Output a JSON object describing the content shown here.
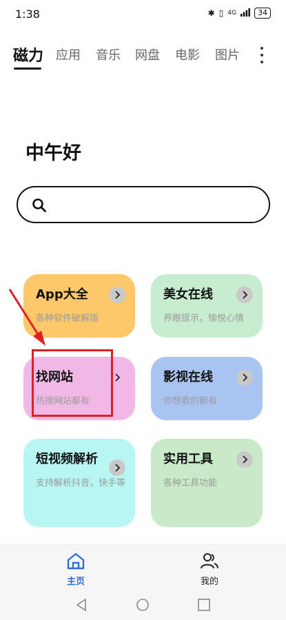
{
  "status_bar": {
    "time": "1:38",
    "bluetooth": "✱",
    "vibrate": "▯",
    "network": "4G",
    "battery": "34"
  },
  "tabs": [
    {
      "label": "磁力",
      "active": true
    },
    {
      "label": "应用"
    },
    {
      "label": "音乐"
    },
    {
      "label": "网盘"
    },
    {
      "label": "电影"
    },
    {
      "label": "图片"
    }
  ],
  "greeting": "中午好",
  "search": {
    "placeholder": "",
    "value": ""
  },
  "cards": [
    {
      "title": "App大全",
      "subtitle": "各种软件破解版",
      "color": "#fcc86a"
    },
    {
      "title": "美女在线",
      "subtitle": "养眼提示，愉悦心情",
      "color": "#c8ecd0"
    },
    {
      "title": "找网站",
      "subtitle": "热搜网站都有",
      "color": "#f1b8e6"
    },
    {
      "title": "影视在线",
      "subtitle": "你想看的都有",
      "color": "#a9c4f0"
    },
    {
      "title": "短视频解析",
      "subtitle": "支持解析抖音，快手等",
      "color": "#b7f6f2"
    },
    {
      "title": "实用工具",
      "subtitle": "各种工具功能",
      "color": "#c8eac9"
    }
  ],
  "bottom_nav": [
    {
      "label": "主页",
      "icon": "home-icon",
      "active": true
    },
    {
      "label": "我的",
      "icon": "users-icon"
    }
  ],
  "colors": {
    "accent": "#2f6ed8",
    "annotation": "#e02020"
  }
}
